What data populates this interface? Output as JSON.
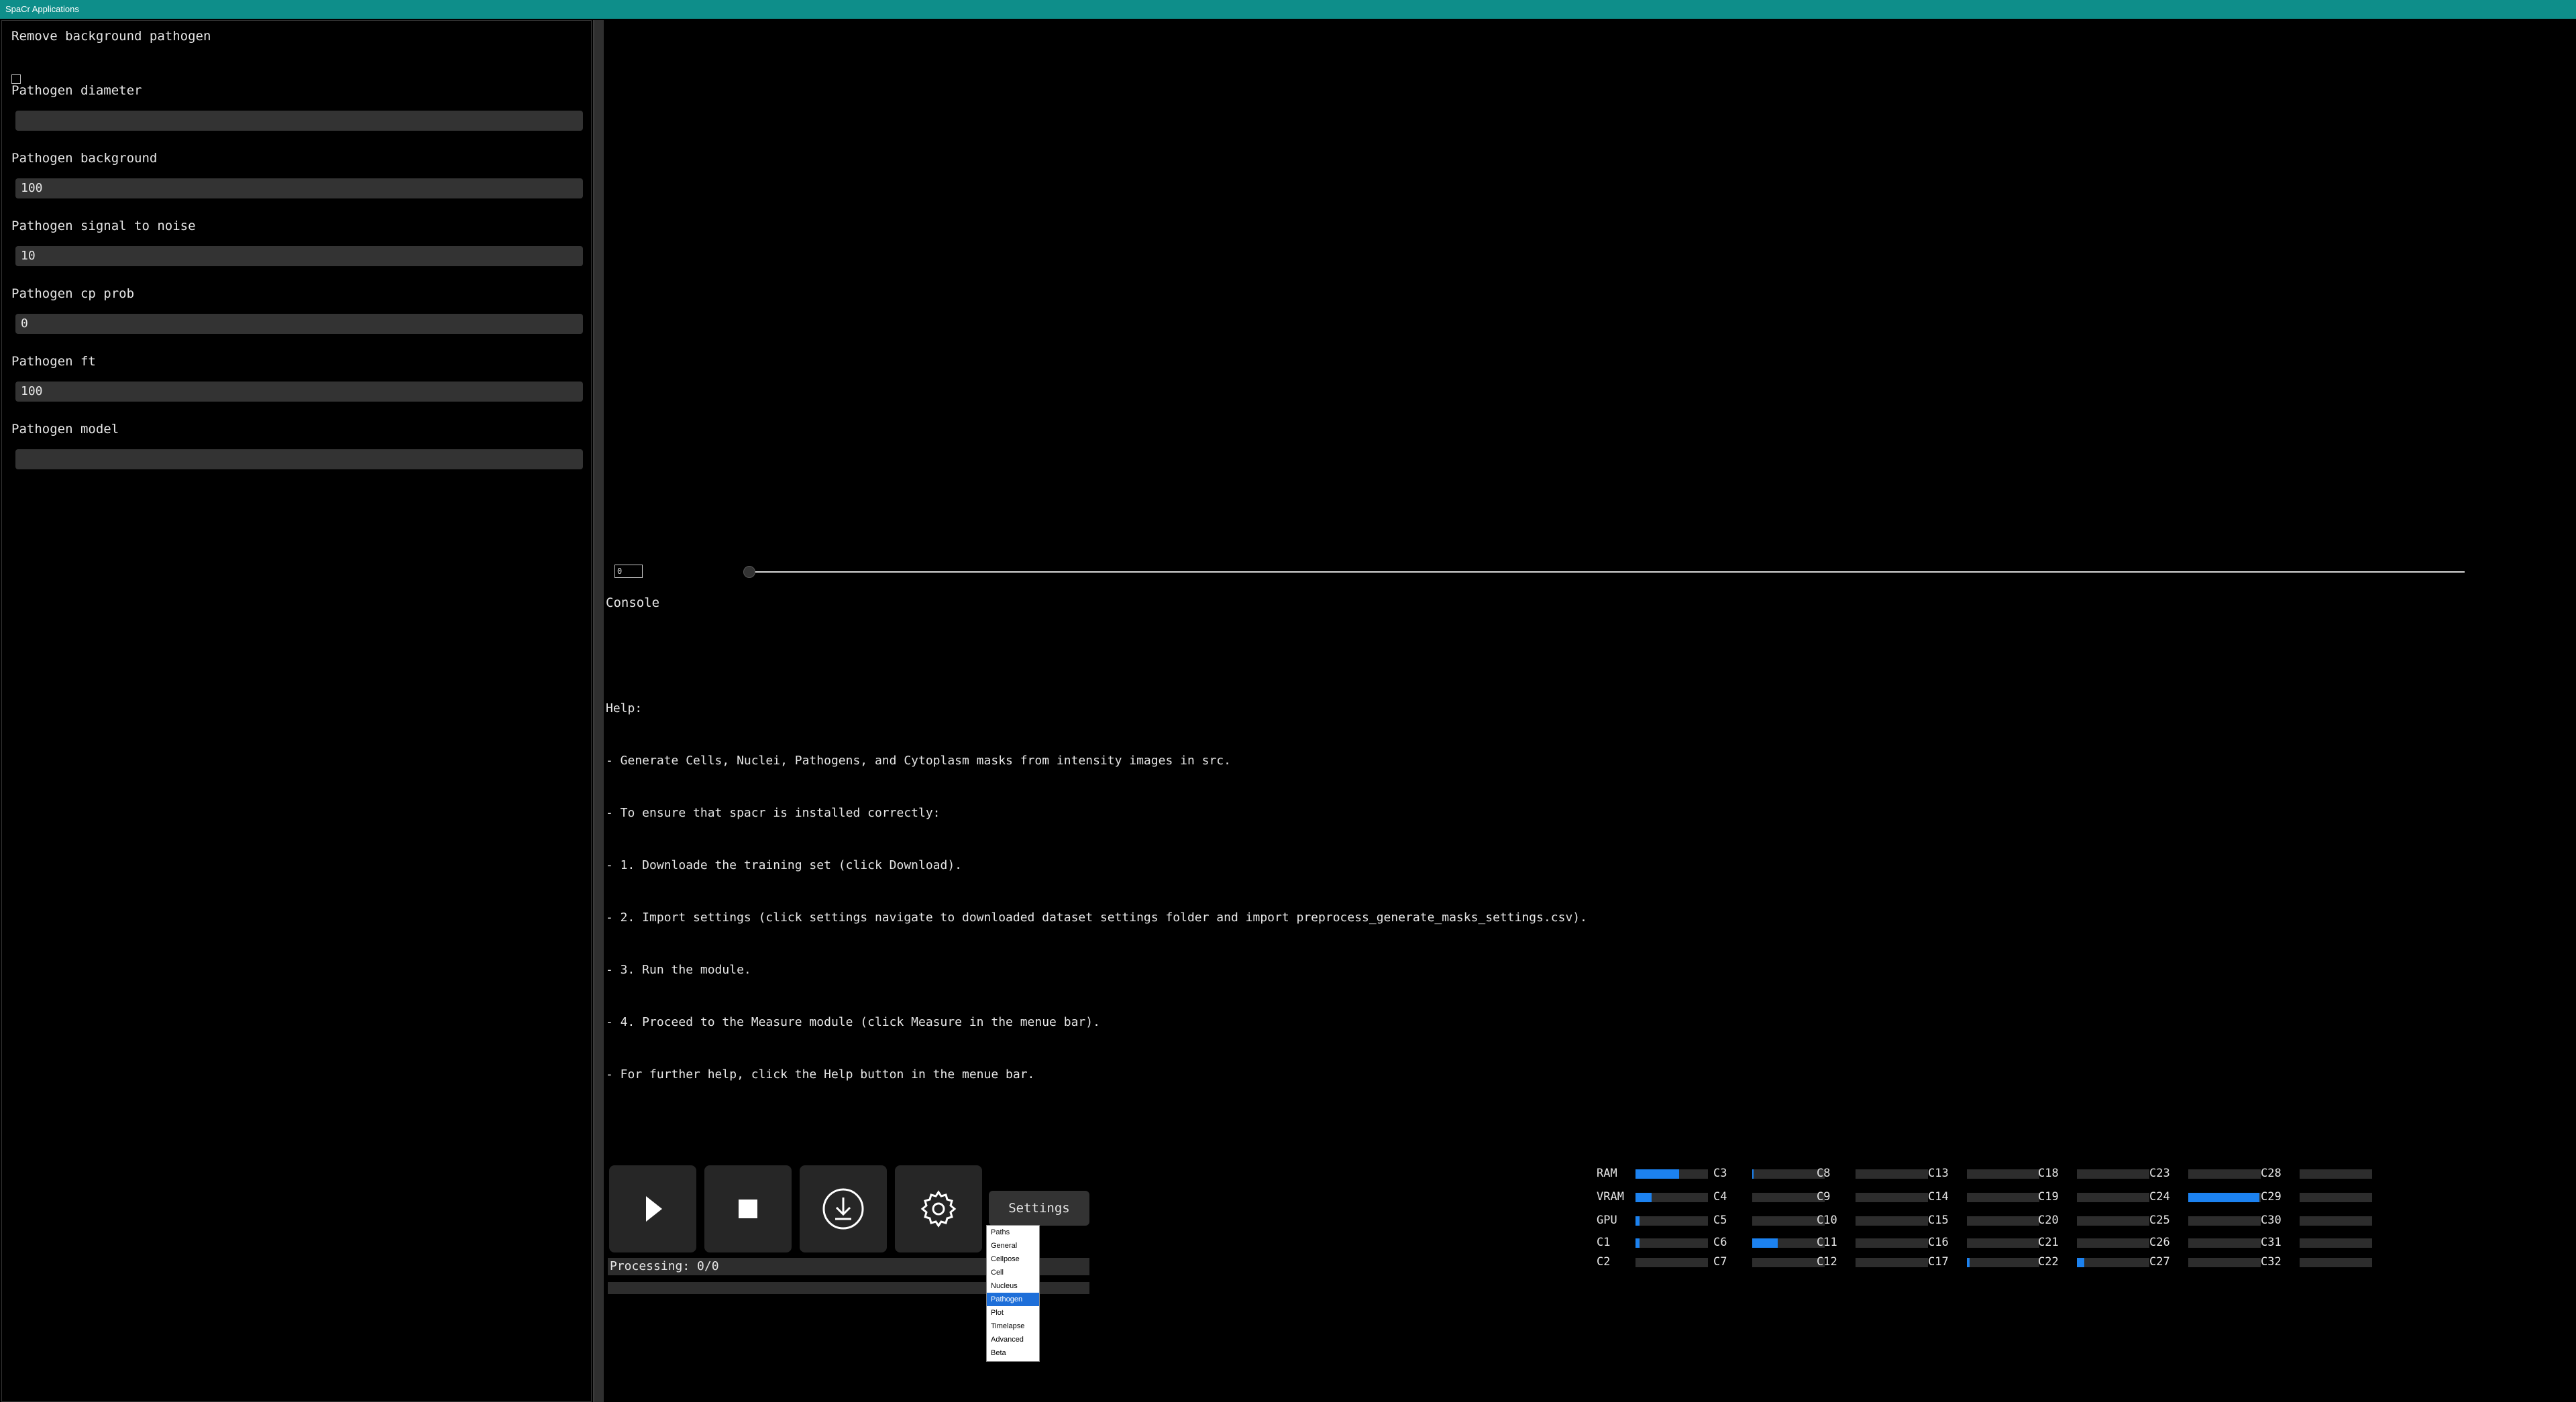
{
  "window": {
    "title": "SpaCr Applications"
  },
  "settings_panel": {
    "remove_bg_label": "Remove background pathogen",
    "fields": [
      {
        "label": "Pathogen diameter",
        "value": ""
      },
      {
        "label": "Pathogen background",
        "value": "100"
      },
      {
        "label": "Pathogen signal to noise",
        "value": "10"
      },
      {
        "label": "Pathogen cp prob",
        "value": "0"
      },
      {
        "label": "Pathogen ft",
        "value": "100"
      },
      {
        "label": "Pathogen model",
        "value": ""
      }
    ]
  },
  "viewer": {
    "frame_value": "0"
  },
  "console": {
    "title": "Console",
    "help_lines": [
      "Help:",
      "- Generate Cells, Nuclei, Pathogens, and Cytoplasm masks from intensity images in src.",
      "- To ensure that spacr is installed correctly:",
      "- 1. Downloade the training set (click Download).",
      "- 2. Import settings (click settings navigate to downloaded dataset settings folder and import preprocess_generate_masks_settings.csv).",
      "- 3. Run the module.",
      "- 4. Proceed to the Measure module (click Measure in the menue bar).",
      "- For further help, click the Help button in the menue bar."
    ]
  },
  "controls": {
    "settings_label": "Settings",
    "processing_label": "Processing: 0/0",
    "dropdown_options": [
      "Paths",
      "General",
      "Cellpose",
      "Cell",
      "Nucleus",
      "Pathogen",
      "Plot",
      "Timelapse",
      "Advanced",
      "Beta"
    ],
    "dropdown_selected": "Pathogen"
  },
  "monitor": {
    "accent_color": "#1c82f0",
    "columns": [
      [
        {
          "label": "RAM",
          "pct": 60
        },
        {
          "label": "VRAM",
          "pct": 22
        },
        {
          "label": "GPU",
          "pct": 6
        },
        {
          "label": "C1",
          "pct": 6
        },
        {
          "label": "C2",
          "pct": 0
        }
      ],
      [
        {
          "label": "C3",
          "pct": 2
        },
        {
          "label": "C4",
          "pct": 0
        },
        {
          "label": "C5",
          "pct": 0
        },
        {
          "label": "C6",
          "pct": 35
        },
        {
          "label": "C7",
          "pct": 0
        }
      ],
      [
        {
          "label": "C8",
          "pct": 0
        },
        {
          "label": "C9",
          "pct": 0
        },
        {
          "label": "C10",
          "pct": 0
        },
        {
          "label": "C11",
          "pct": 0
        },
        {
          "label": "C12",
          "pct": 0
        }
      ],
      [
        {
          "label": "C13",
          "pct": 0
        },
        {
          "label": "C14",
          "pct": 0
        },
        {
          "label": "C15",
          "pct": 0
        },
        {
          "label": "C16",
          "pct": 0
        },
        {
          "label": "C17",
          "pct": 4
        }
      ],
      [
        {
          "label": "C18",
          "pct": 0
        },
        {
          "label": "C19",
          "pct": 0
        },
        {
          "label": "C20",
          "pct": 0
        },
        {
          "label": "C21",
          "pct": 0
        },
        {
          "label": "C22",
          "pct": 10
        }
      ],
      [
        {
          "label": "C23",
          "pct": 0
        },
        {
          "label": "C24",
          "pct": 98
        },
        {
          "label": "C25",
          "pct": 0
        },
        {
          "label": "C26",
          "pct": 0
        },
        {
          "label": "C27",
          "pct": 0
        }
      ],
      [
        {
          "label": "C28",
          "pct": 0
        },
        {
          "label": "C29",
          "pct": 0
        },
        {
          "label": "C30",
          "pct": 0
        },
        {
          "label": "C31",
          "pct": 0
        },
        {
          "label": "C32",
          "pct": 0
        }
      ]
    ]
  }
}
